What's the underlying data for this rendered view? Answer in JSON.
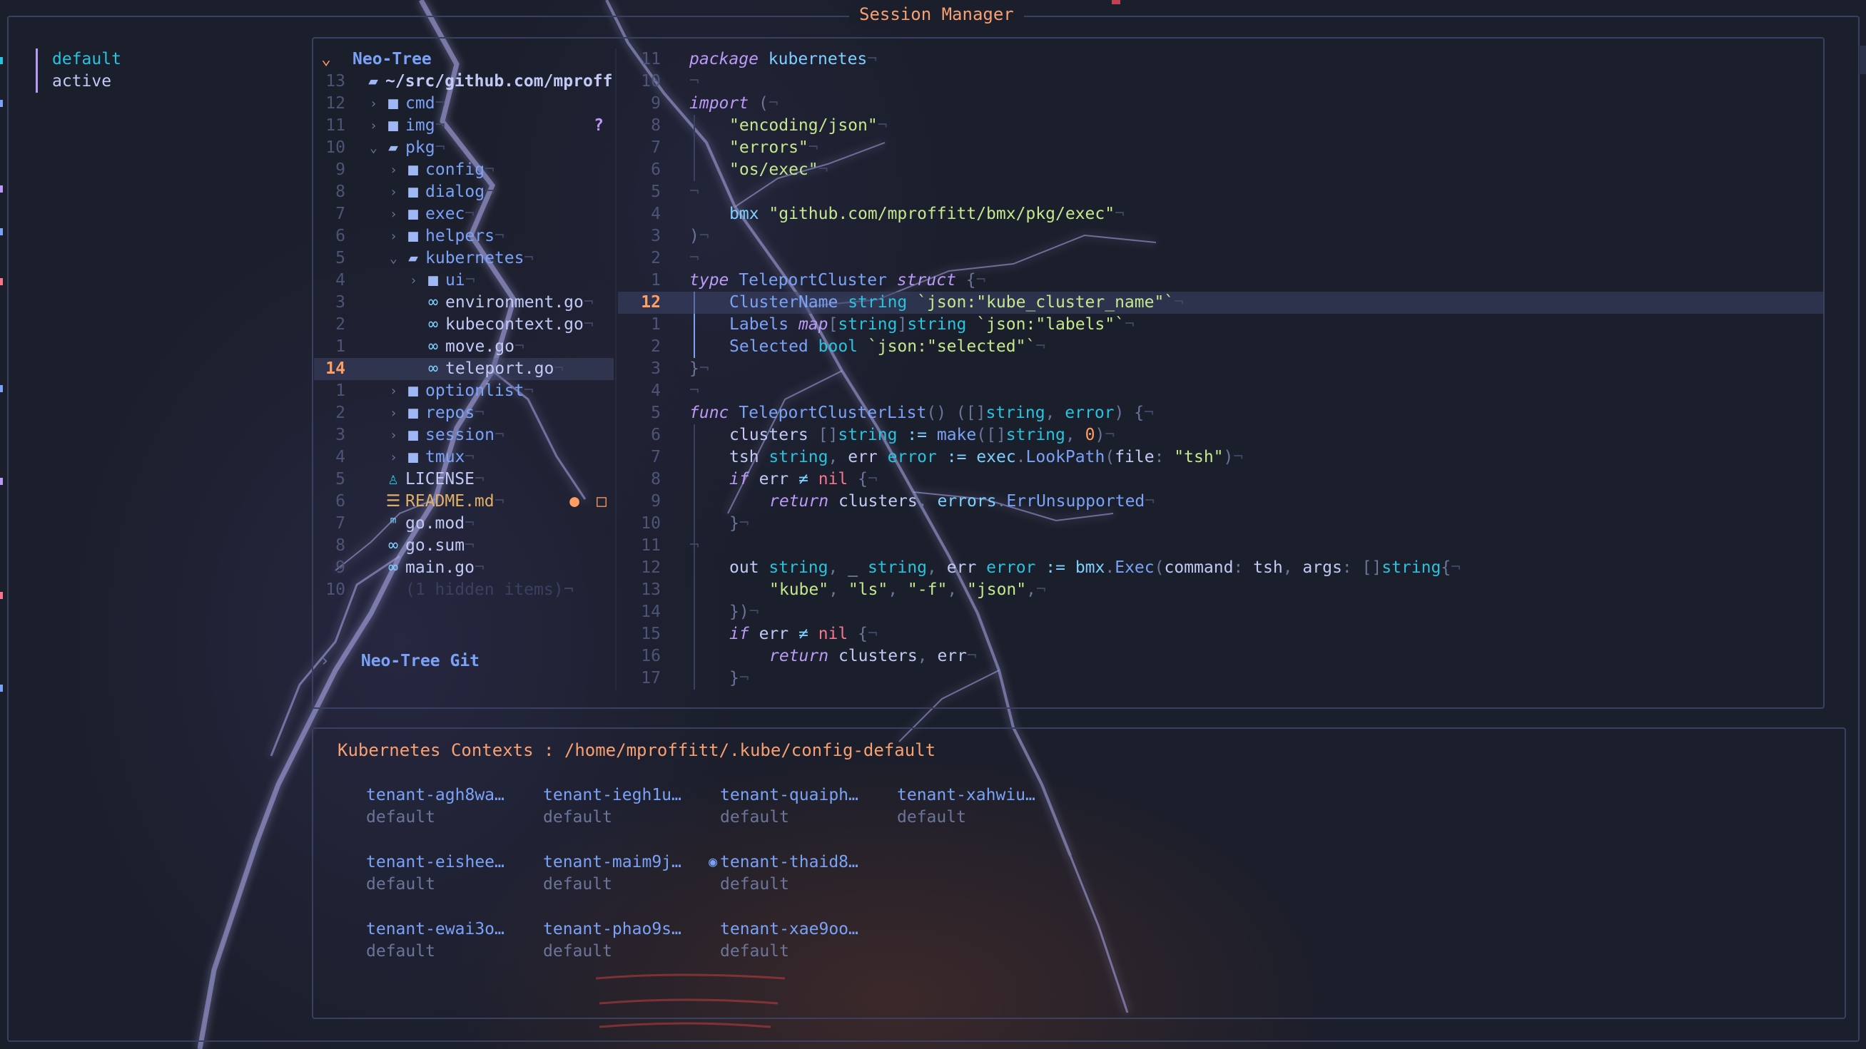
{
  "window": {
    "title": "Session Manager"
  },
  "sessions": [
    {
      "name": "default"
    },
    {
      "name": "active"
    }
  ],
  "tree": {
    "title": "Neo-Tree",
    "git_title": "Neo-Tree Git",
    "rows": [
      {
        "ln": "13",
        "label": "~/src/github.com/mproff",
        "kind": "root"
      },
      {
        "ln": "12",
        "label": "cmd",
        "kind": "dir",
        "depth": 1
      },
      {
        "ln": "11",
        "label": "img",
        "kind": "dir",
        "depth": 1,
        "git": "?"
      },
      {
        "ln": "10",
        "label": "pkg",
        "kind": "dir-open",
        "depth": 1
      },
      {
        "ln": "9",
        "label": "config",
        "kind": "dir",
        "depth": 2
      },
      {
        "ln": "8",
        "label": "dialog",
        "kind": "dir",
        "depth": 2
      },
      {
        "ln": "7",
        "label": "exec",
        "kind": "dir",
        "depth": 2
      },
      {
        "ln": "6",
        "label": "helpers",
        "kind": "dir",
        "depth": 2
      },
      {
        "ln": "5",
        "label": "kubernetes",
        "kind": "dir-open",
        "depth": 2
      },
      {
        "ln": "4",
        "label": "ui",
        "kind": "dir",
        "depth": 3
      },
      {
        "ln": "3",
        "label": "environment.go",
        "kind": "go",
        "depth": 3
      },
      {
        "ln": "2",
        "label": "kubecontext.go",
        "kind": "go",
        "depth": 3
      },
      {
        "ln": "1",
        "label": "move.go",
        "kind": "go",
        "depth": 3
      },
      {
        "ln": "14",
        "label": "teleport.go",
        "kind": "go",
        "depth": 3,
        "selected": true
      },
      {
        "ln": "1",
        "label": "optionlist",
        "kind": "dir",
        "depth": 2
      },
      {
        "ln": "2",
        "label": "repos",
        "kind": "dir",
        "depth": 2
      },
      {
        "ln": "3",
        "label": "session",
        "kind": "dir",
        "depth": 2
      },
      {
        "ln": "4",
        "label": "tmux",
        "kind": "dir",
        "depth": 2
      },
      {
        "ln": "5",
        "label": "LICENSE",
        "kind": "license",
        "depth": 1
      },
      {
        "ln": "6",
        "label": "README.md",
        "kind": "md",
        "depth": 1
      },
      {
        "ln": "7",
        "label": "go.mod",
        "kind": "mod",
        "depth": 1
      },
      {
        "ln": "8",
        "label": "go.sum",
        "kind": "go",
        "depth": 1
      },
      {
        "ln": "9",
        "label": "main.go",
        "kind": "go",
        "depth": 1
      },
      {
        "ln": "10",
        "label": "(1 hidden items)",
        "kind": "hidden",
        "depth": 1
      }
    ]
  },
  "editor": {
    "filename": "teleport.go",
    "current_line": "12",
    "lines": [
      {
        "ln": "11",
        "code": "package kubernetes"
      },
      {
        "ln": "10",
        "code": ""
      },
      {
        "ln": "9",
        "code": "import ("
      },
      {
        "ln": "8",
        "code": "\"encoding/json\""
      },
      {
        "ln": "7",
        "code": "\"errors\""
      },
      {
        "ln": "6",
        "code": "\"os/exec\""
      },
      {
        "ln": "5",
        "code": ""
      },
      {
        "ln": "4",
        "code": "bmx \"github.com/mproffitt/bmx/pkg/exec\""
      },
      {
        "ln": "3",
        "code": ")"
      },
      {
        "ln": "2",
        "code": ""
      },
      {
        "ln": "1",
        "code": "type TeleportCluster struct {"
      },
      {
        "ln": "12",
        "code": "ClusterName string `json:\"kube_cluster_name\"`"
      },
      {
        "ln": "1",
        "code": "Labels map[string]string `json:\"labels\"`"
      },
      {
        "ln": "2",
        "code": "Selected bool `json:\"selected\"`"
      },
      {
        "ln": "3",
        "code": "}"
      },
      {
        "ln": "4",
        "code": ""
      },
      {
        "ln": "5",
        "code": "func TeleportClusterList() ([]string, error) {"
      },
      {
        "ln": "6",
        "code": "clusters []string := make([]string, 0)"
      },
      {
        "ln": "7",
        "code": "tsh string, err error := exec.LookPath(file: \"tsh\")"
      },
      {
        "ln": "8",
        "code": "if err ≠ nil {"
      },
      {
        "ln": "9",
        "code": "return clusters, errors.ErrUnsupported"
      },
      {
        "ln": "10",
        "code": "}"
      },
      {
        "ln": "11",
        "code": ""
      },
      {
        "ln": "12",
        "code": "out string, _ string, err error := bmx.Exec(command: tsh, args: []string{"
      },
      {
        "ln": "13",
        "code": "\"kube\", \"ls\", \"-f\", \"json\","
      },
      {
        "ln": "14",
        "code": "})"
      },
      {
        "ln": "15",
        "code": "if err ≠ nil {"
      },
      {
        "ln": "16",
        "code": "return clusters, err"
      },
      {
        "ln": "17",
        "code": "}"
      }
    ]
  },
  "kubernetes": {
    "title": "Kubernetes Contexts : /home/mproffitt/.kube/config-default",
    "contexts": [
      {
        "name": "tenant-agh8wa…",
        "namespace": "default"
      },
      {
        "name": "tenant-iegh1u…",
        "namespace": "default"
      },
      {
        "name": "tenant-quaiph…",
        "namespace": "default"
      },
      {
        "name": "tenant-xahwiu…",
        "namespace": "default"
      },
      {
        "name": "tenant-eishee…",
        "namespace": "default"
      },
      {
        "name": "tenant-maim9j…",
        "namespace": "default",
        "selected": true
      },
      {
        "name": "tenant-thaid8…",
        "namespace": "default"
      },
      {
        "name": "tenant-ewai3o…",
        "namespace": "default"
      },
      {
        "name": "tenant-phao9s…",
        "namespace": "default"
      },
      {
        "name": "tenant-xae9oo…",
        "namespace": "default"
      }
    ]
  },
  "colors": {
    "background": "#1b1e2b",
    "accent": "#7aa2f7",
    "title": "#f7a072",
    "session_active": "#2ac3de",
    "current_line_number": "#ff9e64"
  }
}
